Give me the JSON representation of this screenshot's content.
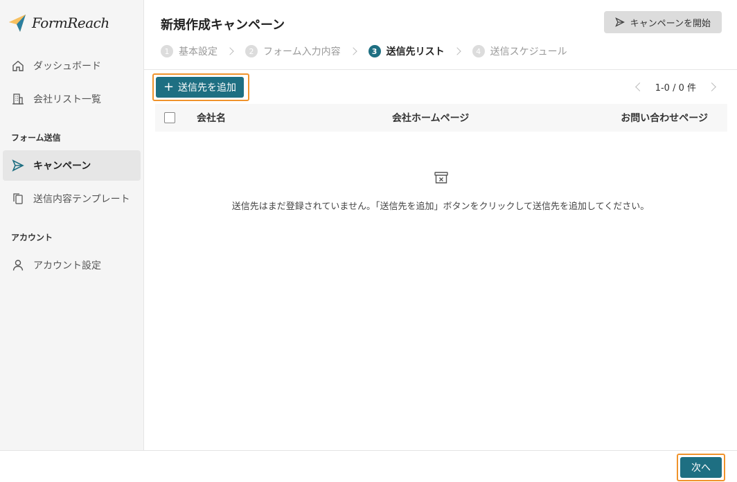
{
  "app": {
    "name": "FormReach",
    "logo_color": "#f0a030"
  },
  "sidebar": {
    "items": [
      {
        "label": "ダッシュボード",
        "icon": "home-icon"
      },
      {
        "label": "会社リスト一覧",
        "icon": "building-icon"
      }
    ],
    "section_form": "フォーム送信",
    "form_items": [
      {
        "label": "キャンペーン",
        "icon": "send-icon",
        "active": true
      },
      {
        "label": "送信内容テンプレート",
        "icon": "copy-icon"
      }
    ],
    "section_account": "アカウント",
    "account_items": [
      {
        "label": "アカウント設定",
        "icon": "user-icon"
      }
    ]
  },
  "header": {
    "title": "新規作成キャンペーン",
    "start_button": "キャンペーンを開始"
  },
  "steps": [
    {
      "num": "1",
      "label": "基本設定"
    },
    {
      "num": "2",
      "label": "フォーム入力内容"
    },
    {
      "num": "3",
      "label": "送信先リスト",
      "active": true
    },
    {
      "num": "4",
      "label": "送信スケジュール"
    }
  ],
  "toolbar": {
    "add_label": "送信先を追加",
    "pagination": "1-0 / 0 件"
  },
  "table": {
    "columns": [
      "会社名",
      "会社ホームページ",
      "お問い合わせページ"
    ],
    "empty_message": "送信先はまだ登録されていません。「送信先を追加」ボタンをクリックして送信先を追加してください。"
  },
  "footer": {
    "next_label": "次へ"
  },
  "colors": {
    "primary": "#1e6f82",
    "highlight": "#f0932b"
  }
}
